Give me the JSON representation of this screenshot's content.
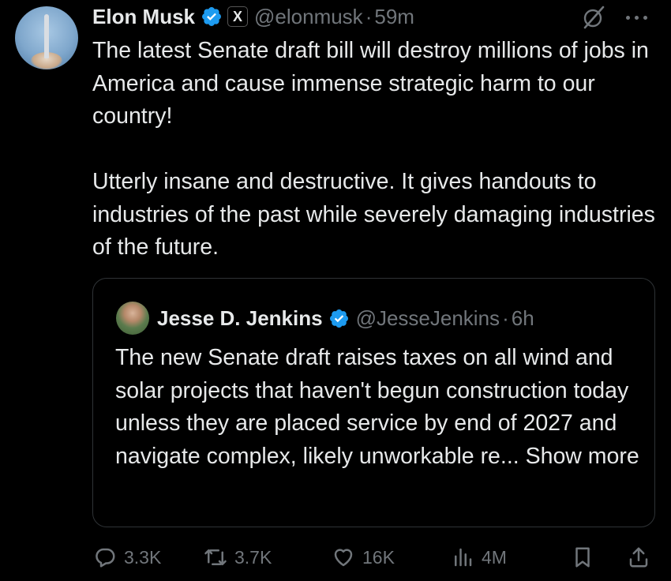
{
  "tweet": {
    "author_name": "Elon Musk",
    "affiliate_badge": "X",
    "handle": "@elonmusk",
    "separator": "·",
    "time": "59m",
    "paragraphs": [
      "The latest Senate draft bill will destroy millions of jobs in America and cause immense strategic harm to our country!",
      "Utterly insane and destructive. It gives handouts to industries of the past while severely damaging industries of the future."
    ]
  },
  "quote": {
    "author_name": "Jesse D. Jenkins",
    "handle": "@JesseJenkins",
    "separator": "·",
    "time": "6h",
    "text": "The new Senate draft raises taxes on all wind and solar projects that haven't begun construction today unless they are placed service by end of 2027 and navigate complex, likely unworkable re... ",
    "show_more": "Show more"
  },
  "actions": {
    "replies": "3.3K",
    "reposts": "3.7K",
    "likes": "16K",
    "views": "4M"
  },
  "icons": {
    "verified": "verified-badge-icon",
    "grok": "grok-icon",
    "more": "more-options-icon",
    "reply": "reply-icon",
    "repost": "repost-icon",
    "like": "heart-icon",
    "views": "views-chart-icon",
    "bookmark": "bookmark-icon",
    "share": "share-icon"
  },
  "colors": {
    "background": "#000000",
    "text": "#e7e9ea",
    "muted": "#71767b",
    "verified": "#1d9bf0",
    "border": "#2f3336"
  }
}
